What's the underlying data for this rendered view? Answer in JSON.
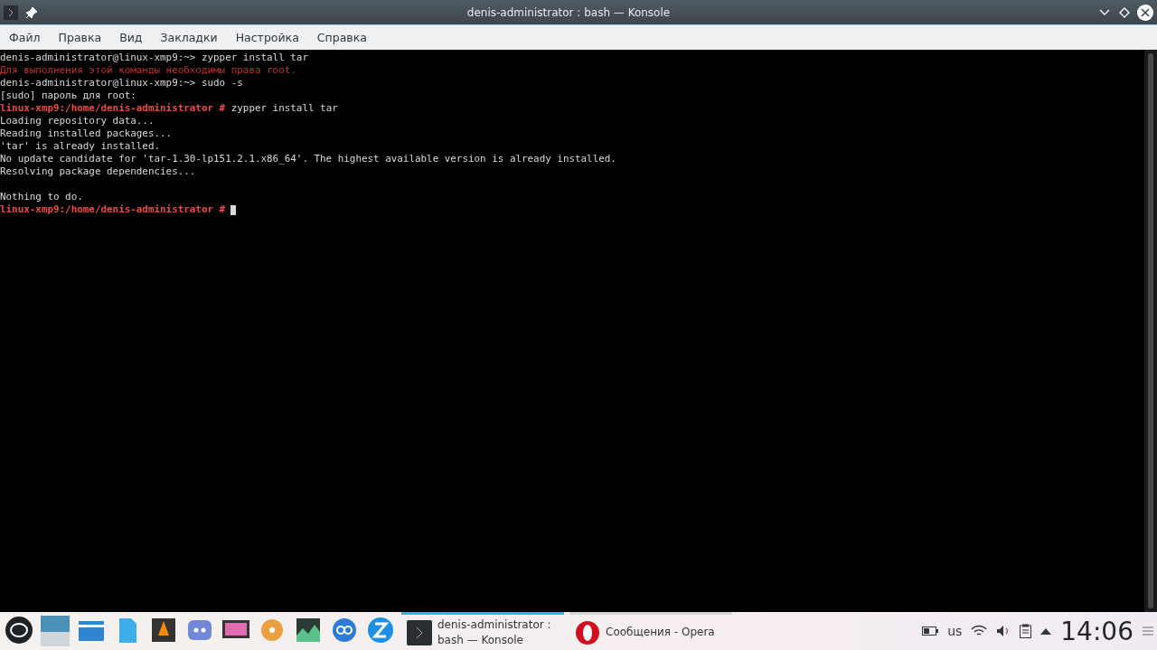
{
  "window": {
    "title": "denis-administrator : bash — Konsole"
  },
  "menu": [
    "Файл",
    "Правка",
    "Вид",
    "Закладки",
    "Настройка",
    "Справка"
  ],
  "terminal": {
    "lines": [
      {
        "kind": "user",
        "prompt": "denis-administrator@linux-xmp9:~>",
        "text": "zypper install tar"
      },
      {
        "kind": "error",
        "text": "Для выполнения этой команды необходимы права root."
      },
      {
        "kind": "user",
        "prompt": "denis-administrator@linux-xmp9:~>",
        "text": "sudo -s"
      },
      {
        "kind": "output",
        "text": "[sudo] пароль для root:"
      },
      {
        "kind": "root",
        "prompt": "linux-xmp9:/home/denis-administrator #",
        "text": "zypper install tar"
      },
      {
        "kind": "output",
        "text": "Loading repository data..."
      },
      {
        "kind": "output",
        "text": "Reading installed packages..."
      },
      {
        "kind": "output",
        "text": "'tar' is already installed."
      },
      {
        "kind": "output",
        "text": "No update candidate for 'tar-1.30-lp151.2.1.x86_64'. The highest available version is already installed."
      },
      {
        "kind": "output",
        "text": "Resolving package dependencies..."
      },
      {
        "kind": "blank"
      },
      {
        "kind": "output",
        "text": "Nothing to do."
      },
      {
        "kind": "root",
        "prompt": "linux-xmp9:/home/denis-administrator #",
        "cursor": true
      }
    ]
  },
  "taskbar": {
    "tasks": [
      {
        "lines": [
          "denis-administrator :",
          "bash — Konsole"
        ],
        "selected": true,
        "kind": "konsole"
      },
      {
        "lines": [
          "Сообщения - Opera"
        ],
        "selected": false,
        "kind": "opera"
      }
    ],
    "keyboard_layout": "us",
    "clock": "14:06"
  }
}
